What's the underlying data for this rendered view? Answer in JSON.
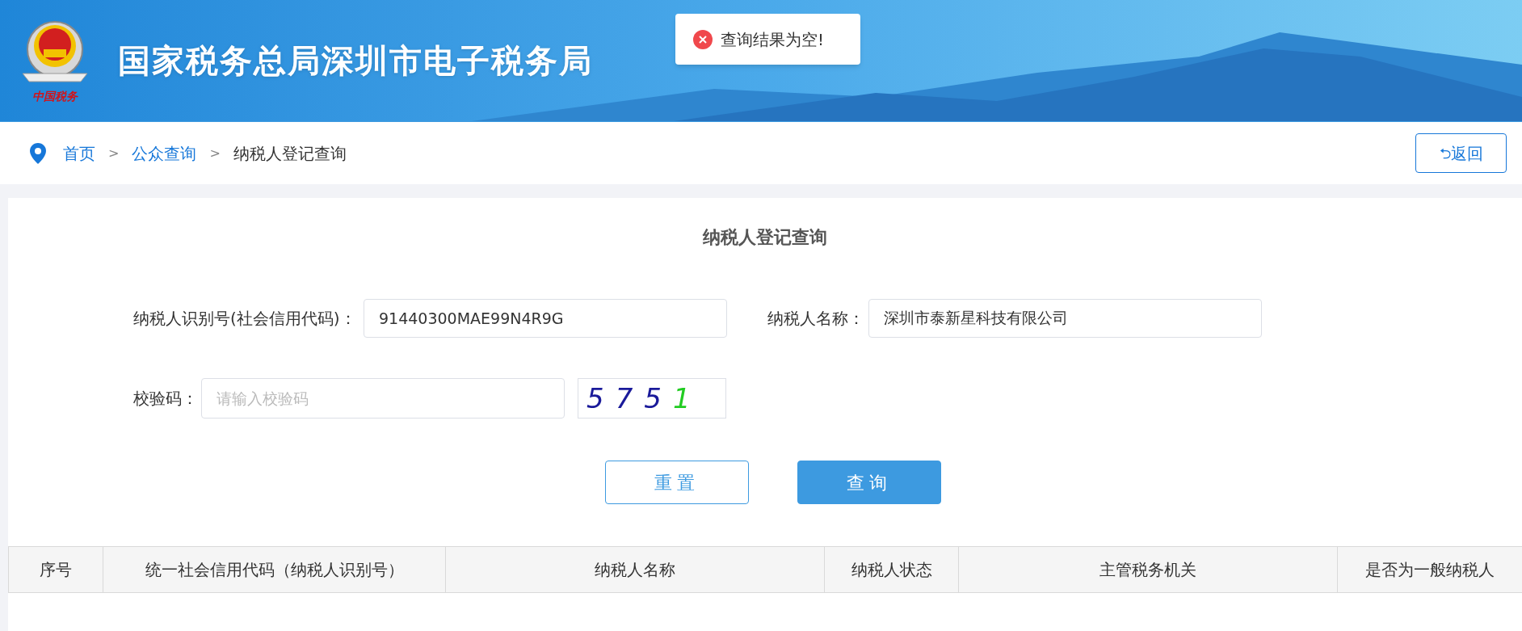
{
  "header": {
    "logo_caption": "中国税务",
    "title": "国家税务总局深圳市电子税务局"
  },
  "toast": {
    "message": "查询结果为空!"
  },
  "breadcrumb": [
    {
      "label": "首页",
      "link": true
    },
    {
      "label": "公众查询",
      "link": true
    },
    {
      "label": "纳税人登记查询",
      "link": false
    }
  ],
  "breadcrumb_separator": ">",
  "back_button": {
    "icon": "⮌",
    "label": "返回"
  },
  "form": {
    "title": "纳税人登记查询",
    "fields": [
      {
        "label": "纳税人识别号(社会信用代码)：",
        "value": "91440300MAE99N4R9G"
      },
      {
        "label": "纳税人名称：",
        "value": "深圳市泰新星科技有限公司"
      },
      {
        "label": "校验码：",
        "placeholder": "请输入校验码"
      }
    ],
    "captcha": [
      {
        "char": "5",
        "color": "#1a1a9a"
      },
      {
        "char": "7",
        "color": "#1a1a9a"
      },
      {
        "char": "5",
        "color": "#1a1a9a"
      },
      {
        "char": "1",
        "color": "#22cc22"
      }
    ],
    "buttons": [
      {
        "label": "重置",
        "kind": "outline"
      },
      {
        "label": "查询",
        "kind": "primary"
      }
    ]
  },
  "table": {
    "columns": [
      "序号",
      "统一社会信用代码（纳税人识别号）",
      "纳税人名称",
      "纳税人状态",
      "主管税务机关",
      "是否为一般纳税人"
    ]
  }
}
